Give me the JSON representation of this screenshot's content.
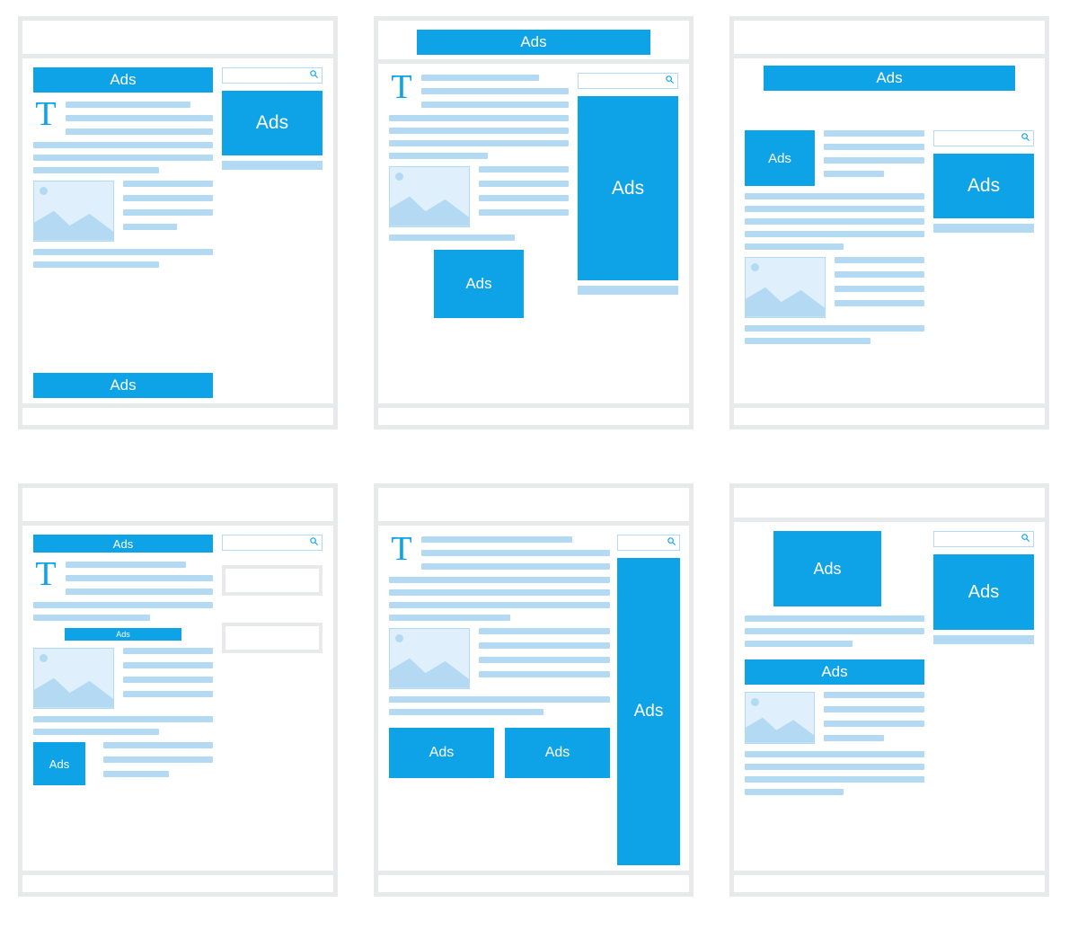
{
  "label": {
    "ads": "Ads",
    "dropcap": "T"
  },
  "colors": {
    "primary": "#0ea3e6",
    "muted": "#b4d9f2",
    "frame": "#e7e9eb"
  },
  "panels": [
    {
      "id": 1
    },
    {
      "id": 2
    },
    {
      "id": 3
    },
    {
      "id": 4
    },
    {
      "id": 5
    },
    {
      "id": 6
    }
  ]
}
